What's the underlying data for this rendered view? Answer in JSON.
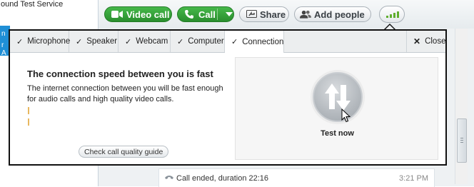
{
  "sidebar": {
    "contact_name": "ound Test Service",
    "selected_snippet": [
      "n",
      "r A"
    ]
  },
  "toolbar": {
    "video_call_label": "Video call",
    "call_label": "Call",
    "share_label": "Share",
    "add_people_label": "Add people",
    "signal_icon": "signal-bars-icon"
  },
  "connection_panel": {
    "tabs": [
      {
        "label": "Microphone",
        "checked": true
      },
      {
        "label": "Speaker",
        "checked": true
      },
      {
        "label": "Webcam",
        "checked": true
      },
      {
        "label": "Computer",
        "checked": true
      },
      {
        "label": "Connection",
        "checked": true,
        "active": true
      }
    ],
    "close_label": "Close",
    "heading": "The connection speed between you is fast",
    "description": "The internet connection between you will be fast enough for audio calls and high quality video calls.",
    "guide_button_label": "Check call quality guide",
    "test_now_label": "Test now"
  },
  "chat": {
    "message": "Call ended, duration 22:16",
    "time": "3:21 PM"
  },
  "colors": {
    "accent_green": "#2a8f2e",
    "selected_blue": "#1f8fd6",
    "panel_border": "#111111"
  }
}
